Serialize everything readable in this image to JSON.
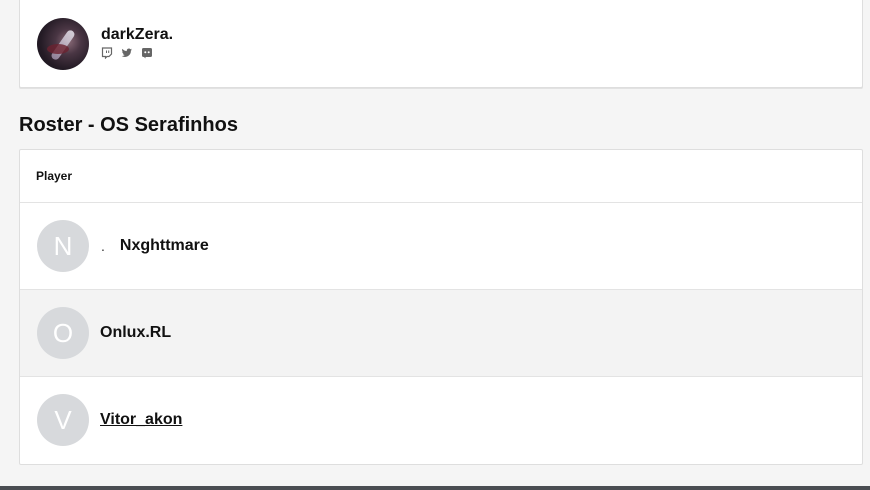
{
  "profile": {
    "name": "darkZera.",
    "socials": [
      "twitch-icon",
      "twitter-icon",
      "discord-icon"
    ]
  },
  "roster": {
    "title": "Roster - OS Serafinhos",
    "column_header": "Player",
    "players": [
      {
        "initial": "N",
        "prefix": ".",
        "name": "Nxghttmare"
      },
      {
        "initial": "O",
        "name": "Onlux.RL"
      },
      {
        "initial": "V",
        "name": "Vitor_akon"
      }
    ]
  },
  "colors": {
    "background": "#f5f5f5",
    "avatar_placeholder": "#d7d9dc",
    "alt_row": "#f3f3f3"
  }
}
